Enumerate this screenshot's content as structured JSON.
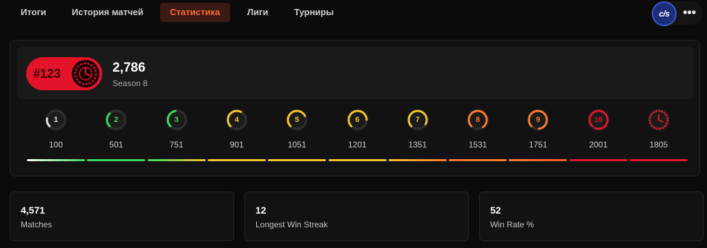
{
  "nav": {
    "tabs": [
      {
        "label": "Итоги",
        "active": false
      },
      {
        "label": "История матчей",
        "active": false
      },
      {
        "label": "Статистика",
        "active": true
      },
      {
        "label": "Лиги",
        "active": false
      },
      {
        "label": "Турниры",
        "active": false
      }
    ],
    "avatar_text": "c/s",
    "more_label": "•••"
  },
  "season": {
    "rank": "#123",
    "elo": "2,786",
    "name": "Season 8",
    "rank_color": "#e3142a"
  },
  "levels": [
    {
      "level": "1",
      "min": "100",
      "color": "#e6e6e6",
      "fill": 0.15
    },
    {
      "level": "2",
      "min": "501",
      "color": "#3ddc5c",
      "fill": 0.25
    },
    {
      "level": "3",
      "min": "751",
      "color": "#3ddc5c",
      "fill": 0.35
    },
    {
      "level": "4",
      "min": "901",
      "color": "#f5c531",
      "fill": 0.45
    },
    {
      "level": "5",
      "min": "1051",
      "color": "#f5c531",
      "fill": 0.55
    },
    {
      "level": "6",
      "min": "1201",
      "color": "#f5c531",
      "fill": 0.62
    },
    {
      "level": "7",
      "min": "1351",
      "color": "#f5c531",
      "fill": 0.7
    },
    {
      "level": "8",
      "min": "1531",
      "color": "#ff7a2e",
      "fill": 0.77
    },
    {
      "level": "9",
      "min": "1751",
      "color": "#ff7a2e",
      "fill": 0.85
    },
    {
      "level": "10",
      "min": "2001",
      "color": "#e3142a",
      "fill": 0.93
    },
    {
      "level": "",
      "min": "1805",
      "color": "#e3142a",
      "fill": 1.0
    }
  ],
  "level_bars": [
    {
      "from": "#ffffff",
      "to": "#3ddc5c"
    },
    {
      "from": "#3ddc5c",
      "to": "#3ddc5c"
    },
    {
      "from": "#3ddc5c",
      "to": "#f5c531"
    },
    {
      "from": "#f5c531",
      "to": "#f5c531"
    },
    {
      "from": "#f5c531",
      "to": "#f5c531"
    },
    {
      "from": "#f5c531",
      "to": "#f5c531"
    },
    {
      "from": "#f5c531",
      "to": "#ff7a2e"
    },
    {
      "from": "#ff7a2e",
      "to": "#ff7a2e"
    },
    {
      "from": "#ff7a2e",
      "to": "#ff5a2e"
    },
    {
      "from": "#e3142a",
      "to": "#e3142a"
    },
    {
      "from": "#e3142a",
      "to": "#e3142a"
    }
  ],
  "stats": [
    {
      "value": "4,571",
      "label": "Matches"
    },
    {
      "value": "12",
      "label": "Longest Win Streak"
    },
    {
      "value": "52",
      "label": "Win Rate %"
    }
  ]
}
